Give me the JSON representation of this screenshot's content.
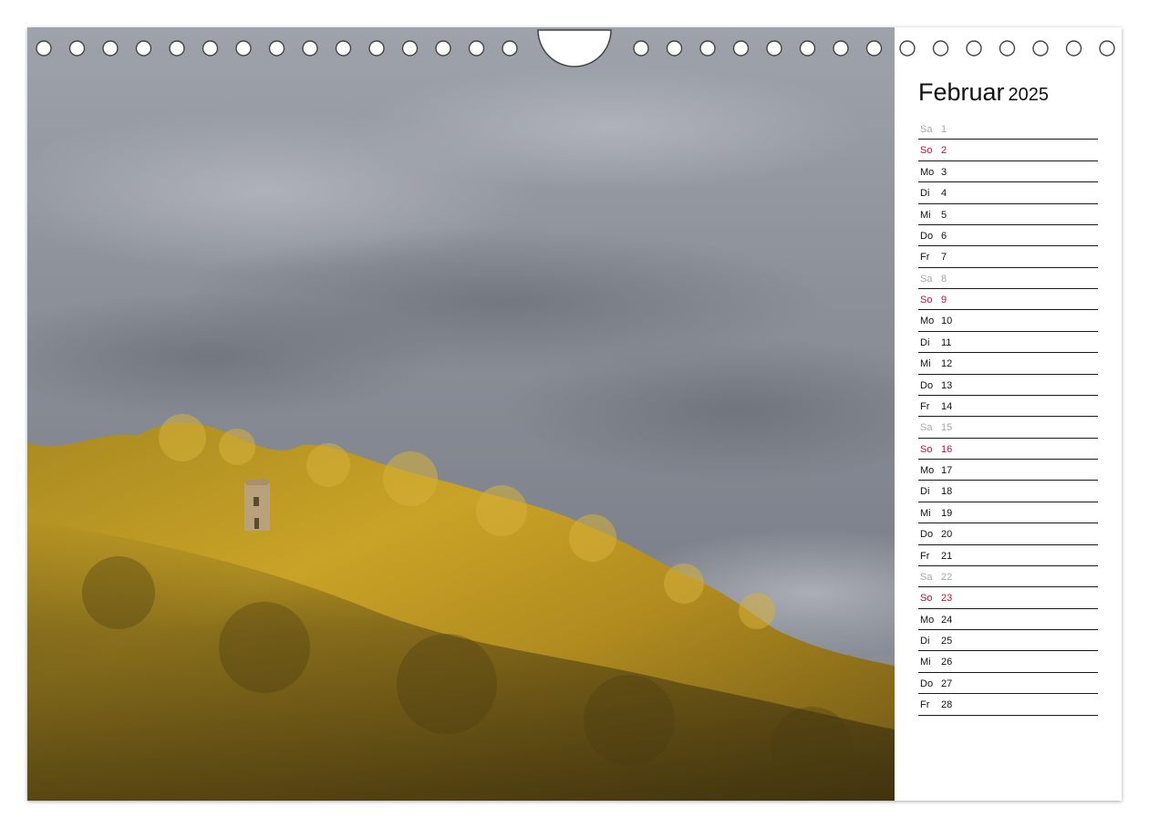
{
  "calendar": {
    "month": "Februar",
    "year": "2025",
    "days": [
      {
        "wd": "Sa",
        "d": "1",
        "kind": "sat"
      },
      {
        "wd": "So",
        "d": "2",
        "kind": "sun"
      },
      {
        "wd": "Mo",
        "d": "3",
        "kind": "weekday"
      },
      {
        "wd": "Di",
        "d": "4",
        "kind": "weekday"
      },
      {
        "wd": "Mi",
        "d": "5",
        "kind": "weekday"
      },
      {
        "wd": "Do",
        "d": "6",
        "kind": "weekday"
      },
      {
        "wd": "Fr",
        "d": "7",
        "kind": "weekday"
      },
      {
        "wd": "Sa",
        "d": "8",
        "kind": "sat"
      },
      {
        "wd": "So",
        "d": "9",
        "kind": "sun"
      },
      {
        "wd": "Mo",
        "d": "10",
        "kind": "weekday"
      },
      {
        "wd": "Di",
        "d": "11",
        "kind": "weekday"
      },
      {
        "wd": "Mi",
        "d": "12",
        "kind": "weekday"
      },
      {
        "wd": "Do",
        "d": "13",
        "kind": "weekday"
      },
      {
        "wd": "Fr",
        "d": "14",
        "kind": "weekday"
      },
      {
        "wd": "Sa",
        "d": "15",
        "kind": "sat"
      },
      {
        "wd": "So",
        "d": "16",
        "kind": "sun"
      },
      {
        "wd": "Mo",
        "d": "17",
        "kind": "weekday"
      },
      {
        "wd": "Di",
        "d": "18",
        "kind": "weekday"
      },
      {
        "wd": "Mi",
        "d": "19",
        "kind": "weekday"
      },
      {
        "wd": "Do",
        "d": "20",
        "kind": "weekday"
      },
      {
        "wd": "Fr",
        "d": "21",
        "kind": "weekday"
      },
      {
        "wd": "Sa",
        "d": "22",
        "kind": "sat"
      },
      {
        "wd": "So",
        "d": "23",
        "kind": "sun"
      },
      {
        "wd": "Mo",
        "d": "24",
        "kind": "weekday"
      },
      {
        "wd": "Di",
        "d": "25",
        "kind": "weekday"
      },
      {
        "wd": "Mi",
        "d": "26",
        "kind": "weekday"
      },
      {
        "wd": "Do",
        "d": "27",
        "kind": "weekday"
      },
      {
        "wd": "Fr",
        "d": "28",
        "kind": "weekday"
      }
    ]
  },
  "colors": {
    "sunday": "#c8102e",
    "saturday": "#a8a8a8",
    "weekday": "#111111",
    "sky": "#8e929b",
    "forest_lit": "#c9a326",
    "forest_shadow": "#5a4a16"
  },
  "photo": {
    "subject": "ruined-tower-on-forested-hill"
  }
}
